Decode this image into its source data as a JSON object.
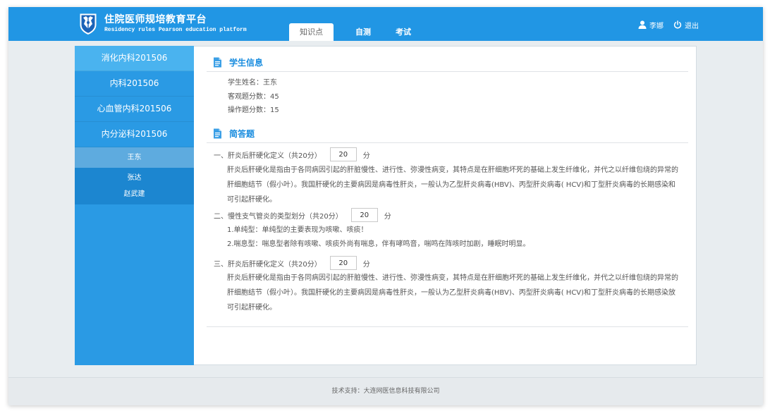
{
  "header": {
    "logo_icon": "hospital-emblem-icon",
    "title": "住院医师规培教育平台",
    "subtitle": "Residency rules Pearson education platform",
    "tabs": [
      {
        "label": "知识点",
        "active": true
      },
      {
        "label": "自测",
        "active": false
      },
      {
        "label": "考试",
        "active": false
      }
    ],
    "user": {
      "icon": "user-icon",
      "name": "李娜"
    },
    "logout": {
      "icon": "power-icon",
      "label": "退出"
    }
  },
  "sidebar": {
    "departments": [
      {
        "label": "消化内科201506",
        "active": true
      },
      {
        "label": "内科201506",
        "active": false
      },
      {
        "label": "心血管内科201506",
        "active": false
      },
      {
        "label": "内分泌科201506",
        "active": false
      }
    ],
    "students": [
      {
        "name": "王东",
        "selected": true
      },
      {
        "name": "张达",
        "selected": false
      },
      {
        "name": "赵武建",
        "selected": false
      }
    ]
  },
  "student_info": {
    "icon": "document-icon",
    "title": "学生信息",
    "fields": [
      {
        "label": "学生姓名：",
        "value": "王东"
      },
      {
        "label": "客观题分数：",
        "value": "45"
      },
      {
        "label": "操作题分数：",
        "value": "15"
      }
    ]
  },
  "short_answer": {
    "icon": "document-icon",
    "title": "简答题",
    "score_unit": "分",
    "questions": [
      {
        "title": "一、肝炎后肝硬化定义（共20分）",
        "score": "20",
        "answer_lines": [
          "肝炎后肝硬化是指由于各同病因引起的肝脏慢性、进行性、弥漫性病变，其特点是在肝细胞坏死的基础上发生纤维化，并代之以纤维包绕的异常的",
          "肝细胞结节（假小叶）。我国肝硬化的主要病因是病毒性肝炎，一般认为乙型肝炎病毒(HBV)、丙型肝炎病毒( HCV)和丁型肝炎病毒的长期感染和",
          "可引起肝硬化。"
        ]
      },
      {
        "title": "二、慢性支气管炎的类型划分（共20分）",
        "score": "20",
        "answer_lines": [
          "1.单纯型：单纯型的主要表现为咳嗽、咳痰！",
          "2.喘息型：喘息型者除有咳嗽、咳痰外尚有喘息，伴有哮鸣音，喘鸣在阵咳时加剧，睡眠时明显。"
        ]
      },
      {
        "title": "三、肝炎后肝硬化定义（共20分）",
        "score": "20",
        "answer_lines": [
          "肝炎后肝硬化是指由于各同病因引起的肝脏慢性、进行性、弥漫性病变，其特点是在肝细胞坏死的基础上发生纤维化，并代之以纤维包绕的异常的",
          "肝细胞结节（假小叶）。我国肝硬化的主要病因是病毒性肝炎，一般认为乙型肝炎病毒(HBV)、丙型肝炎病毒( HCV)和丁型肝炎病毒的长期感染放",
          "可引起肝硬化。"
        ]
      }
    ]
  },
  "footer": {
    "text": "技术支持：大连网医信息科技有限公司"
  },
  "colors": {
    "header_bg": "#2196e4",
    "sidebar_bg": "#2a9ae4",
    "sidebar_active": "#4ab3ef",
    "student_list_bg": "#1c86d0",
    "student_selected": "#5eabdf",
    "section_title": "#1a8ddf",
    "page_bg": "#e8edf0"
  }
}
